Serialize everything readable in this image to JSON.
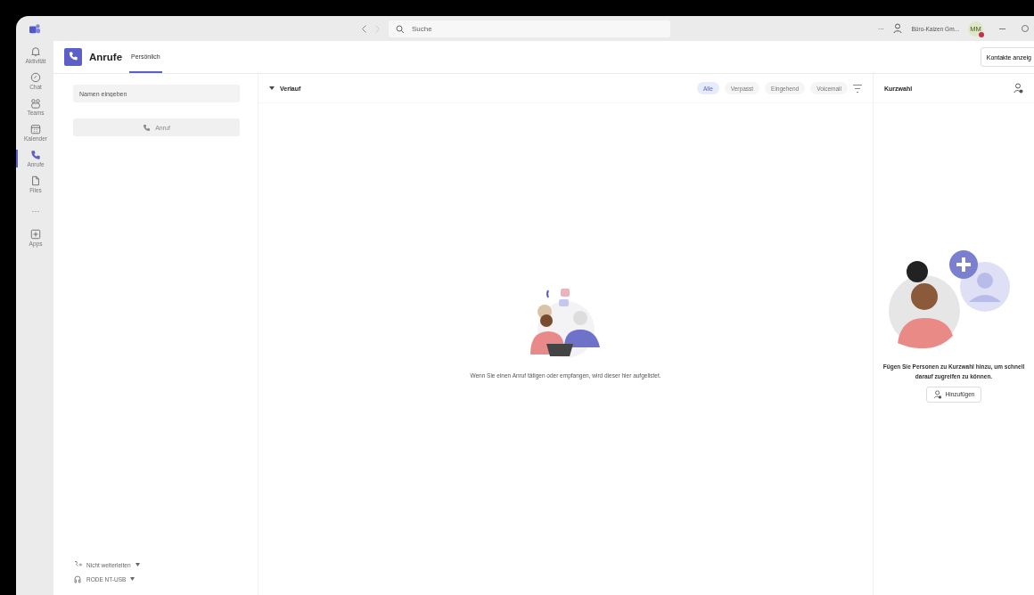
{
  "titlebar": {
    "search": {
      "placeholder": "Suche"
    },
    "more": "···",
    "org": "Büro-Kaizen Gm...",
    "avatar": {
      "initials": "MM",
      "busy": true
    }
  },
  "rail": [
    {
      "label": "Aktivität",
      "selected": false
    },
    {
      "label": "Chat",
      "selected": false
    },
    {
      "label": "Teams",
      "selected": false
    },
    {
      "label": "Kalender",
      "selected": false
    },
    {
      "label": "Anrufe",
      "selected": true
    },
    {
      "label": "Files",
      "selected": false
    },
    {
      "label": "···",
      "selected": false
    },
    {
      "label": "Apps",
      "selected": false
    }
  ],
  "header": {
    "title": "Anrufe",
    "tabs": [
      {
        "label": "Persönlich",
        "selected": true
      }
    ],
    "contacts_button": "Kontakte anzeig"
  },
  "dialer": {
    "placeholder": "Namen eingeben",
    "call_button": "Anruf",
    "call_disabled": true,
    "forwarding": "Nicht weiterleiten",
    "device": "RODE NT-USB"
  },
  "history": {
    "title": "Verlauf",
    "expanded": true,
    "filters": [
      {
        "label": "Alle",
        "selected": true
      },
      {
        "label": "Verpasst",
        "selected": false
      },
      {
        "label": "Eingehend",
        "selected": false
      },
      {
        "label": "Voicemail",
        "selected": false
      }
    ],
    "empty_text": "Wenn Sie einen Anruf tätigen oder empfangen, wird dieser hier aufgelistet."
  },
  "speed_dial": {
    "title": "Kurzwahl",
    "empty_text": "Fügen Sie Personen zu Kurzwahl hinzu, um schnell darauf zugreifen zu können.",
    "add_button": "Hinzufügen"
  }
}
